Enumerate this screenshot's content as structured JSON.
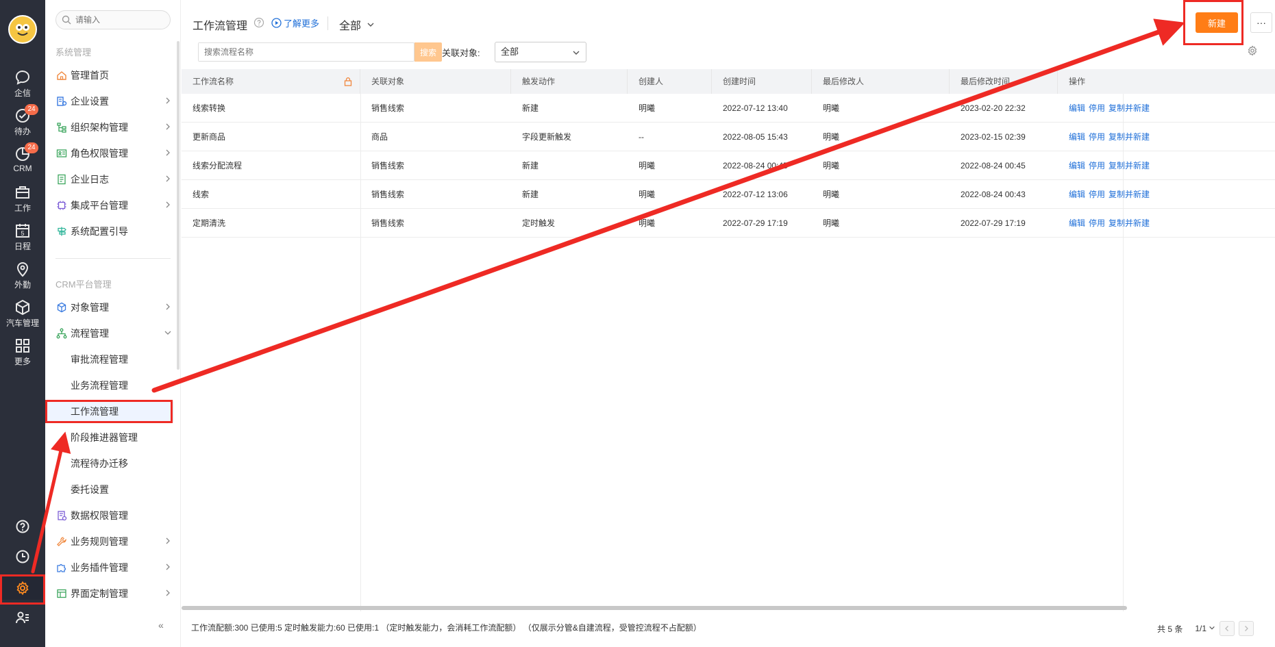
{
  "rail": {
    "items": [
      {
        "label": "企信",
        "icon": "chat-bubble-icon",
        "badge": ""
      },
      {
        "label": "待办",
        "icon": "check-circle-icon",
        "badge": "24"
      },
      {
        "label": "CRM",
        "icon": "pie-chart-icon",
        "badge": "24"
      },
      {
        "label": "工作",
        "icon": "briefcase-icon",
        "badge": ""
      },
      {
        "label": "日程",
        "icon": "calendar-icon",
        "badge": ""
      },
      {
        "label": "外勤",
        "icon": "location-pin-icon",
        "badge": ""
      },
      {
        "label": "汽车管理",
        "icon": "cube-icon",
        "badge": ""
      },
      {
        "label": "更多",
        "icon": "grid-icon",
        "badge": ""
      }
    ],
    "calendar_day": "5"
  },
  "sidebar": {
    "search_placeholder": "请输入",
    "section_system": "系统管理",
    "system_items": [
      {
        "label": "管理首页",
        "icon": "home-icon"
      },
      {
        "label": "企业设置",
        "icon": "building-settings-icon"
      },
      {
        "label": "组织架构管理",
        "icon": "org-tree-icon"
      },
      {
        "label": "角色权限管理",
        "icon": "id-card-icon"
      },
      {
        "label": "企业日志",
        "icon": "log-document-icon"
      },
      {
        "label": "集成平台管理",
        "icon": "chip-icon"
      },
      {
        "label": "系统配置引导",
        "icon": "signpost-icon"
      }
    ],
    "section_crm": "CRM平台管理",
    "crm_items": [
      {
        "label": "对象管理",
        "icon": "object-box-icon"
      },
      {
        "label": "流程管理",
        "icon": "flow-icon"
      }
    ],
    "flow_sub_items": [
      "审批流程管理",
      "业务流程管理",
      "工作流管理",
      "阶段推进器管理",
      "流程待办迁移",
      "委托设置"
    ],
    "more_items": [
      {
        "label": "数据权限管理",
        "icon": "data-permission-icon"
      },
      {
        "label": "业务规则管理",
        "icon": "wrench-icon"
      },
      {
        "label": "业务插件管理",
        "icon": "puzzle-icon"
      },
      {
        "label": "界面定制管理",
        "icon": "layout-icon"
      }
    ],
    "collapse_label": "«"
  },
  "header": {
    "title": "工作流管理",
    "learn_more": "了解更多",
    "scope": "全部",
    "new_button": "新建",
    "more_button": "···"
  },
  "filters": {
    "search_placeholder": "搜索流程名称",
    "search_button": "搜索",
    "assoc_label": "关联对象:",
    "assoc_value": "全部"
  },
  "table": {
    "columns": [
      "工作流名称",
      "关联对象",
      "触发动作",
      "创建人",
      "创建时间",
      "最后修改人",
      "最后修改时间",
      "操作"
    ],
    "rows": [
      {
        "name": "线索转换",
        "object": "销售线索",
        "trigger": "新建",
        "creator": "明曦",
        "created": "2022-07-12 13:40",
        "modifier": "明曦",
        "modified": "2023-02-20 22:32"
      },
      {
        "name": "更新商品",
        "object": "商品",
        "trigger": "字段更新触发",
        "creator": "--",
        "created": "2022-08-05 15:43",
        "modifier": "明曦",
        "modified": "2023-02-15 02:39"
      },
      {
        "name": "线索分配流程",
        "object": "销售线索",
        "trigger": "新建",
        "creator": "明曦",
        "created": "2022-08-24 00:45",
        "modifier": "明曦",
        "modified": "2022-08-24 00:45"
      },
      {
        "name": "线索",
        "object": "销售线索",
        "trigger": "新建",
        "creator": "明曦",
        "created": "2022-07-12 13:06",
        "modifier": "明曦",
        "modified": "2022-08-24 00:43"
      },
      {
        "name": "定期清洗",
        "object": "销售线索",
        "trigger": "定时触发",
        "creator": "明曦",
        "created": "2022-07-29 17:19",
        "modifier": "明曦",
        "modified": "2022-07-29 17:19"
      }
    ],
    "actions": [
      "编辑",
      "停用",
      "复制并新建"
    ]
  },
  "footer": {
    "quota_text": "工作流配额:300 已使用:5 定时触发能力:60 已使用:1 （定时触发能力，会消耗工作流配额） （仅展示分管&自建流程，受管控流程不占配额）",
    "total": "共 5 条",
    "page": "1/1"
  },
  "colors": {
    "accent": "#ff7d16",
    "link": "#1f6fd8",
    "rail_bg": "#2b2f3a",
    "annotation": "#ee2a24"
  }
}
